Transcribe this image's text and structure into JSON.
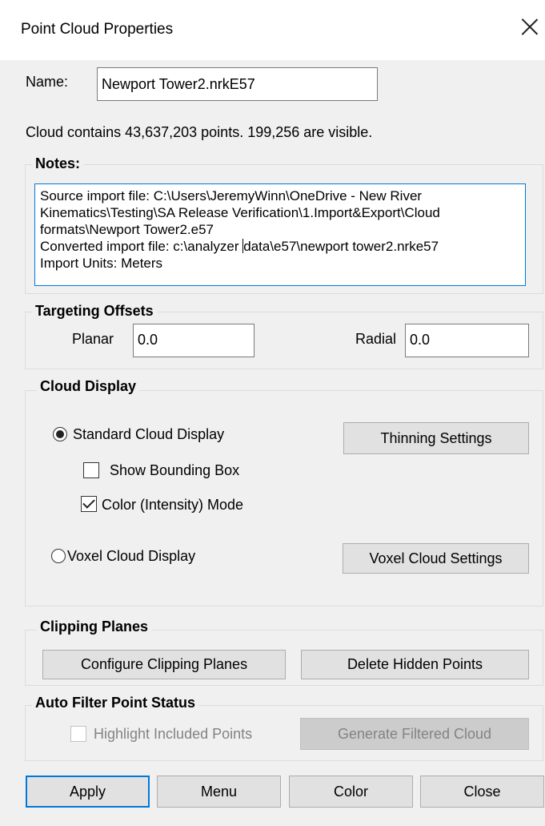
{
  "window": {
    "title": "Point Cloud Properties"
  },
  "name": {
    "label": "Name:",
    "value": "Newport Tower2.nrkE57"
  },
  "summary": "Cloud contains 43,637,203 points.  199,256 are visible.",
  "notes": {
    "legend": "Notes:",
    "lines": [
      "Source import file: C:\\Users\\JeremyWinn\\OneDrive - New River",
      "Kinematics\\Testing\\SA Release Verification\\1.Import&Export\\Cloud",
      "formats\\Newport Tower2.e57",
      "Converted import file: c:\\analyzer",
      "data\\e57\\newport tower2.nrke57",
      "Import Units: Meters"
    ]
  },
  "targeting_offsets": {
    "legend": "Targeting Offsets",
    "planar_label": "Planar",
    "planar_value": "0.0",
    "radial_label": "Radial",
    "radial_value": "0.0"
  },
  "cloud_display": {
    "legend": "Cloud Display",
    "standard_label": "Standard Cloud Display",
    "standard_selected": true,
    "thinning_button": "Thinning Settings",
    "show_bounding_box_label": "Show Bounding Box",
    "show_bounding_box_checked": false,
    "color_mode_label": "Color (Intensity) Mode",
    "color_mode_checked": true,
    "voxel_label": "Voxel Cloud Display",
    "voxel_selected": false,
    "voxel_button": "Voxel Cloud Settings"
  },
  "clipping_planes": {
    "legend": "Clipping Planes",
    "configure_button": "Configure Clipping Planes",
    "delete_button": "Delete Hidden Points"
  },
  "auto_filter": {
    "legend": "Auto Filter Point Status",
    "highlight_label": "Highlight Included Points",
    "highlight_checked": false,
    "generate_button": "Generate Filtered Cloud"
  },
  "footer": {
    "apply": "Apply",
    "menu": "Menu",
    "color": "Color",
    "close": "Close"
  },
  "icons": {
    "close": "close-icon"
  },
  "colors": {
    "focus_border": "#0078d7",
    "button_bg": "#e1e1e1",
    "dialog_bg": "#f0f0f0"
  }
}
